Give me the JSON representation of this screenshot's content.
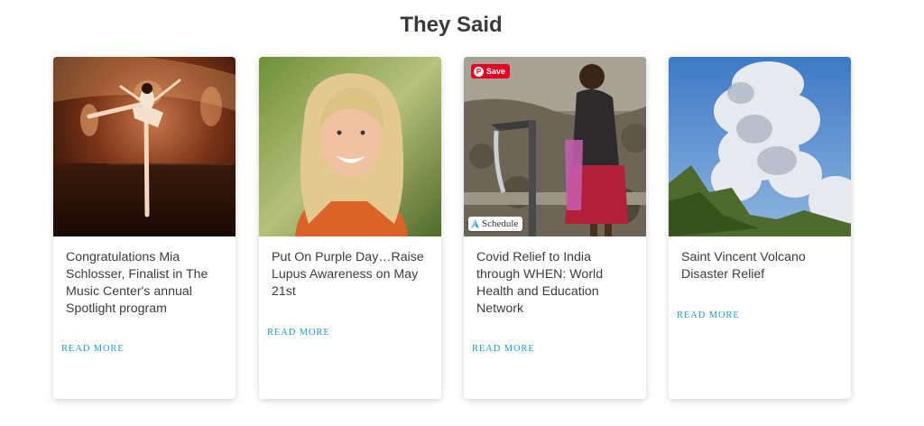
{
  "section": {
    "title": "They Said"
  },
  "cards": [
    {
      "title": "Congratulations Mia Schlosser, Finalist in The Music Center's annual Spotlight program",
      "read_more": "READ MORE",
      "image": "ballet-dancer-photo"
    },
    {
      "title": "Put On Purple Day…Raise Lupus Awareness on May 21st",
      "read_more": "READ MORE",
      "image": "smiling-woman-portrait"
    },
    {
      "title": "Covid Relief to India through WHEN: World Health and Education Network",
      "read_more": "READ MORE",
      "image": "child-at-water-pump-photo",
      "pin_save": "Save",
      "schedule": "Schedule"
    },
    {
      "title": "Saint Vincent Volcano Disaster Relief",
      "read_more": "READ MORE",
      "image": "volcano-eruption-photo"
    }
  ],
  "colors": {
    "link": "#1b9fd4",
    "pinterest": "#e60023",
    "title_text": "#3c3c3c"
  }
}
